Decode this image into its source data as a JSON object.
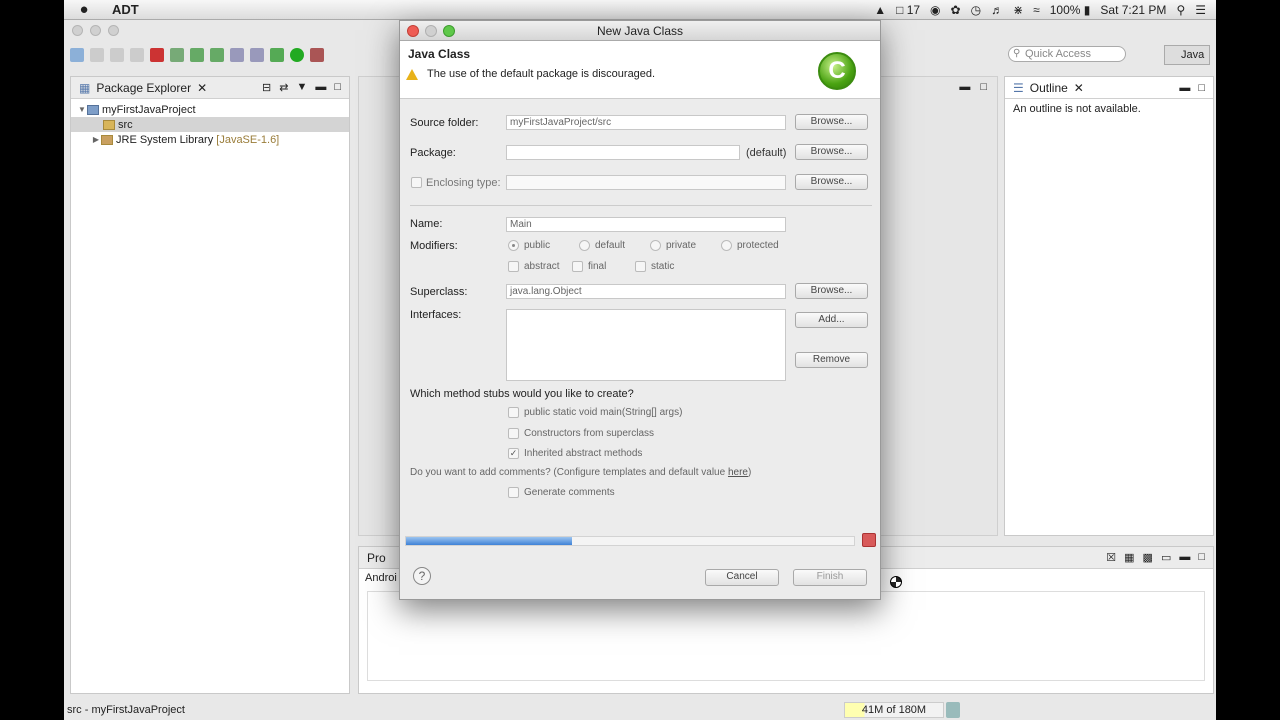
{
  "menubar": {
    "app_name": "ADT",
    "status_badge": "17",
    "battery": "100%",
    "clock": "Sat 7:21 PM"
  },
  "toolbar": {
    "quick_access_placeholder": "Quick Access",
    "perspective_label": "Java"
  },
  "package_explorer": {
    "tab_label": "Package Explorer",
    "project": "myFirstJavaProject",
    "src": "src",
    "jre": "JRE System Library",
    "jre_version": "[JavaSE-1.6]"
  },
  "outline": {
    "tab_label": "Outline",
    "empty_text": "An outline is not available."
  },
  "bottom_panel": {
    "tab_label": "Pro",
    "sub_label": "Androi"
  },
  "statusbar": {
    "selection": "src - myFirstJavaProject",
    "heap": "41M of 180M"
  },
  "dialog": {
    "title": "New Java Class",
    "heading": "Java Class",
    "warning": "The use of the default package is discouraged.",
    "source_folder_label": "Source folder:",
    "source_folder_value": "myFirstJavaProject/src",
    "package_label": "Package:",
    "package_value": "",
    "package_default": "(default)",
    "enclosing_label": "Enclosing type:",
    "name_label": "Name:",
    "name_value": "Main",
    "modifiers_label": "Modifiers:",
    "mod_public": "public",
    "mod_default": "default",
    "mod_private": "private",
    "mod_protected": "protected",
    "mod_abstract": "abstract",
    "mod_final": "final",
    "mod_static": "static",
    "superclass_label": "Superclass:",
    "superclass_value": "java.lang.Object",
    "interfaces_label": "Interfaces:",
    "browse": "Browse...",
    "add": "Add...",
    "remove": "Remove",
    "stubs_question": "Which method stubs would you like to create?",
    "stub_main": "public static void main(String[] args)",
    "stub_constructors": "Constructors from superclass",
    "stub_inherited": "Inherited abstract methods",
    "comments_question": "Do you want to add comments? (Configure templates and default value ",
    "comments_link": "here",
    "comments_suffix": ")",
    "generate_comments": "Generate comments",
    "cancel": "Cancel",
    "finish": "Finish",
    "progress": 0.37
  },
  "colors": {
    "accent_blue": "#3e82d6",
    "warning_yellow": "#e8b21a",
    "logo_green": "#4aa312"
  }
}
